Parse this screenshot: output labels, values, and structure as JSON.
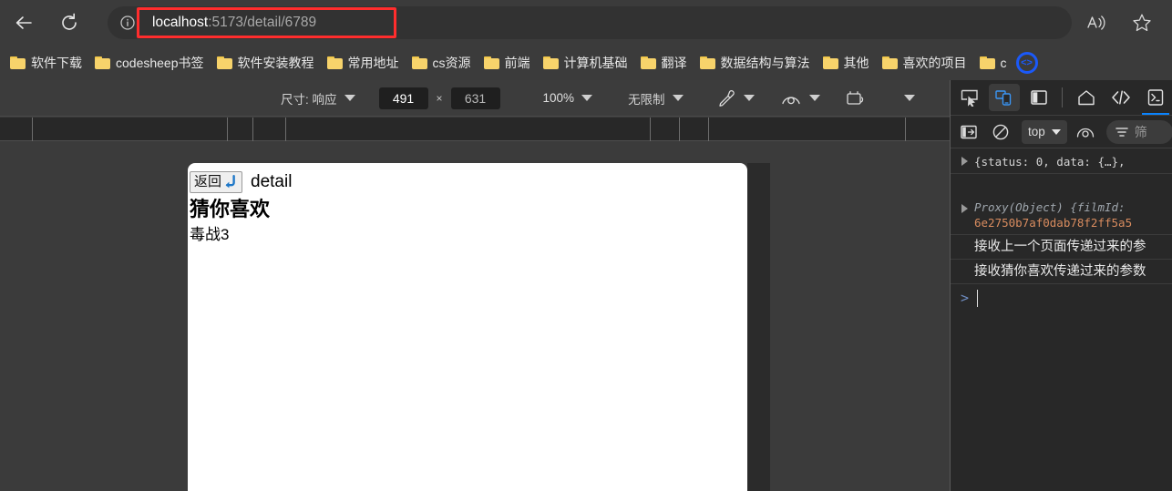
{
  "browser": {
    "back_title": "back-arrow",
    "reload_title": "reload",
    "address": {
      "prefix": "localhost",
      "suffix": ":5173/detail/6789",
      "full": "localhost:5173/detail/6789"
    },
    "info_icon": "info-circle-icon",
    "read_aloud_icon": "read-aloud-icon",
    "favorite_icon": "star-icon",
    "highlight_color": "#ff2d2d"
  },
  "bookmarks": [
    {
      "label": "软件下载"
    },
    {
      "label": "codesheep书签"
    },
    {
      "label": "软件安装教程"
    },
    {
      "label": "常用地址"
    },
    {
      "label": "cs资源"
    },
    {
      "label": "前端"
    },
    {
      "label": "计算机基础"
    },
    {
      "label": "翻译"
    },
    {
      "label": "数据结构与算法"
    },
    {
      "label": "其他"
    },
    {
      "label": "喜欢的项目"
    },
    {
      "label": "c"
    }
  ],
  "device_toolbar": {
    "size_label": "尺寸: 响应",
    "width": "491",
    "height": "631",
    "times": "×",
    "zoom": "100%",
    "throttle": "无限制",
    "pen_icon": "eyedropper-icon",
    "eye_icon": "show-rulers-icon",
    "capture_icon": "capture-screenshot-icon",
    "more_icon": "more-options-icon"
  },
  "page": {
    "back_button": "返回",
    "back_emoji": "back-arrow-emoji",
    "detail_label": "detail",
    "heading": "猜你喜欢",
    "item": "毒战3"
  },
  "devtools": {
    "header_icons": [
      {
        "name": "inspect-element-icon"
      },
      {
        "name": "device-toolbar-icon",
        "active": true
      },
      {
        "name": "panel-layout-icon"
      },
      {
        "name": "home-icon"
      },
      {
        "name": "elements-panel-icon"
      },
      {
        "name": "console-panel-icon",
        "active_tab": true
      }
    ],
    "console_toolbar": {
      "sidebar_icon": "console-sidebar-icon",
      "clear_icon": "clear-console-icon",
      "context": "top",
      "live_expression_icon": "live-expression-icon",
      "filter_icon": "filter-icon",
      "filter_placeholder": "筛"
    },
    "messages": [
      {
        "type": "object",
        "text": "{status: 0, data: {…},"
      },
      {
        "type": "proxy",
        "label": "Proxy(Object) {filmId:",
        "value": "6e2750b7af0dab78f2ff5a5"
      },
      {
        "type": "log",
        "text": "接收上一个页面传递过来的参"
      },
      {
        "type": "log",
        "text": "接收猜你喜欢传递过来的参数"
      }
    ],
    "prompt_symbol": ">"
  }
}
